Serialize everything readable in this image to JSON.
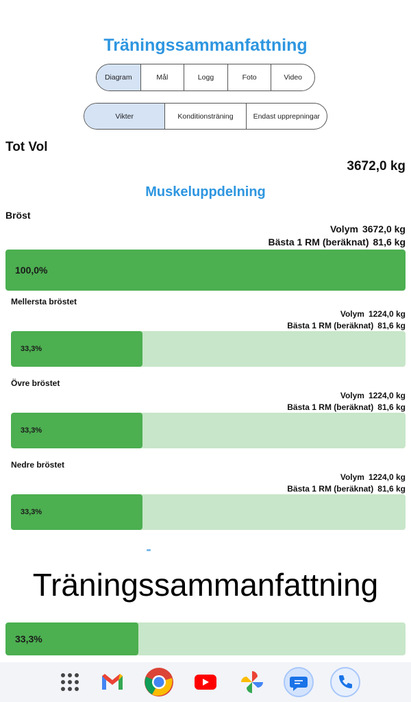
{
  "header": {
    "title": "Träningssammanfattning"
  },
  "tabs1": [
    {
      "label": "Diagram",
      "selected": true
    },
    {
      "label": "Mål",
      "selected": false
    },
    {
      "label": "Logg",
      "selected": false
    },
    {
      "label": "Foto",
      "selected": false
    },
    {
      "label": "Video",
      "selected": false
    }
  ],
  "tabs2": [
    {
      "label": "Vikter",
      "selected": true
    },
    {
      "label": "Konditionsträning",
      "selected": false
    },
    {
      "label": "Endast upprepningar",
      "selected": false
    }
  ],
  "total": {
    "label": "Tot Vol",
    "value": "3672,0 kg"
  },
  "breakdown": {
    "title": "Muskeluppdelning",
    "main": {
      "name": "Bröst",
      "volume_label": "Volym",
      "volume": "3672,0 kg",
      "rm_label": "Bästa 1 RM (beräknat)",
      "rm": "81,6 kg",
      "percent_label": "100,0%",
      "percent": 100
    },
    "subs": [
      {
        "name": "Mellersta bröstet",
        "volume_label": "Volym",
        "volume": "1224,0 kg",
        "rm_label": "Bästa 1 RM (beräknat)",
        "rm": "81,6 kg",
        "percent_label": "33,3%",
        "percent": 33.3
      },
      {
        "name": "Övre bröstet",
        "volume_label": "Volym",
        "volume": "1224,0 kg",
        "rm_label": "Bästa 1 RM (beräknat)",
        "rm": "81,6 kg",
        "percent_label": "33,3%",
        "percent": 33.3
      },
      {
        "name": "Nedre bröstet",
        "volume_label": "Volym",
        "volume": "1224,0 kg",
        "rm_label": "Bästa 1 RM (beräknat)",
        "rm": "81,6 kg",
        "percent_label": "33,3%",
        "percent": 33.3
      }
    ]
  },
  "overlay": {
    "text": "Träningssammanfattning"
  },
  "bottom_bar": {
    "percent_label": "33,3%",
    "percent": 33.3
  },
  "nav_icons": [
    "app-grid-icon",
    "gmail-icon",
    "chrome-icon",
    "youtube-icon",
    "photos-icon",
    "messages-icon",
    "phone-icon"
  ],
  "colors": {
    "accent": "#2e96e0",
    "bar_fill": "#4caf50",
    "bar_track": "#c8e6c9",
    "selected_tab": "#d5e3f5"
  }
}
